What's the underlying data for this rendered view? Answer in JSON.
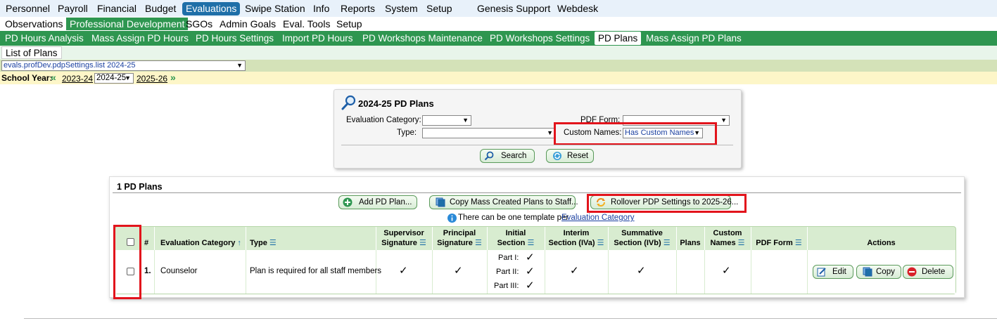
{
  "top_menu": [
    "Personnel",
    "Payroll",
    "Financial",
    "Budget",
    "Evaluations",
    "Swipe Station",
    "Info",
    "Reports",
    "System",
    "Setup",
    "Genesis Support",
    "Webdesk"
  ],
  "sub_menu": [
    "Observations",
    "Professional Development",
    "SGOs",
    "Admin Goals",
    "Eval. Tools",
    "Setup"
  ],
  "third_menu": [
    "PD Hours Analysis",
    "Mass Assign PD Hours",
    "PD Hours Settings",
    "Import PD Hours",
    "PD Workshops Maintenance",
    "PD Workshops Settings",
    "PD Plans",
    "Mass Assign PD Plans"
  ],
  "fourth_tab": "List of Plans",
  "program_select": "evals.profDev.pdpSettings.list 2024-25",
  "school_year": {
    "label": "School Year:",
    "prev": "2023-24",
    "current": "2024-25",
    "next": "2025-26"
  },
  "search": {
    "title": "2024-25 PD Plans",
    "eval_category_label": "Evaluation Category:",
    "type_label": "Type:",
    "pdf_form_label": "PDF Form:",
    "custom_names_label": "Custom Names:",
    "custom_names_value": "Has Custom Names",
    "search_button": "Search",
    "reset_button": "Reset"
  },
  "plans": {
    "title": "1 PD Plans",
    "add_button": "Add PD Plan...",
    "copy_mass_button": "Copy Mass Created Plans to Staff...",
    "rollover_button": "Rollover PDP Settings to 2025-26...",
    "note_prefix": "There can be one template per",
    "note_link": "Evaluation Category",
    "columns": {
      "num": "#",
      "eval_category": "Evaluation Category",
      "type": "Type",
      "supervisor_sig": [
        "Supervisor",
        "Signature"
      ],
      "principal_sig": [
        "Principal",
        "Signature"
      ],
      "initial_section": [
        "Initial",
        "Section"
      ],
      "interim_section": [
        "Interim",
        "Section (IVa)"
      ],
      "summative_section": [
        "Summative",
        "Section (IVb)"
      ],
      "plans": "Plans",
      "custom_names": [
        "Custom",
        "Names"
      ],
      "pdf_form": "PDF Form",
      "actions": "Actions"
    },
    "rows": [
      {
        "num": "1.",
        "eval_category": "Counselor",
        "type": "Plan is required for all staff members",
        "initial_parts": [
          "Part I:",
          "Part II:",
          "Part III:"
        ],
        "edit": "Edit",
        "copy": "Copy",
        "delete": "Delete"
      }
    ]
  },
  "colors": {
    "blue_active": "#1e6fa8",
    "green": "#2e9650",
    "highlight_red": "#e2141c"
  }
}
